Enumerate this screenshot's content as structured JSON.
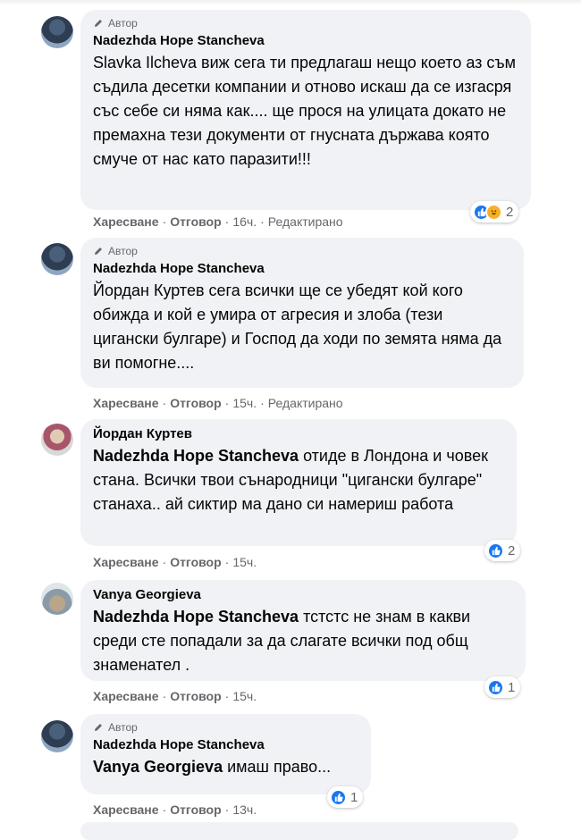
{
  "labels": {
    "author": "Автор",
    "like": "Харесване",
    "reply": "Отговор",
    "edited": "Редактирано"
  },
  "comments": [
    {
      "name": "Nadezhda Hope Stancheva",
      "is_author": true,
      "text": "Slavka Ilcheva виж сега ти предлагаш нещо което аз съм съдила десетки компании и отново искаш да се изгасря със себе си няма как.... ще прося на улицата докато не премахна тези документи от гнусната държава която смуче от нас като паразити!!!",
      "time": "16ч.",
      "edited": true,
      "reactions": [
        "like",
        "haha"
      ],
      "reaction_count": "2"
    },
    {
      "name": "Nadezhda Hope Stancheva",
      "is_author": true,
      "text": "Йордан Куртев сега всички ще се убедят кой кого обижда и кой е умира от агресия и злоба (тези цигански булгаре) и Господ да ходи по земята няма да ви помогне....",
      "time": "15ч.",
      "edited": true,
      "reactions": [],
      "reaction_count": ""
    },
    {
      "name": "Йордан Куртев",
      "is_author": false,
      "mention": "Nadezhda Hope Stancheva",
      "text": " отиде в Лондона и човек стана. Всички твои сънародници \"цигански булгаре\" станаха.. ай сиктир ма дано си намериш работа",
      "time": "15ч.",
      "edited": false,
      "reactions": [
        "like"
      ],
      "reaction_count": "2"
    },
    {
      "name": "Vanya Georgieva",
      "is_author": false,
      "mention": "Nadezhda Hope Stancheva",
      "text": " тстстс не знам в какви среди сте попадали за да слагате всички под общ знаменател .",
      "time": "15ч.",
      "edited": false,
      "reactions": [
        "like"
      ],
      "reaction_count": "1"
    },
    {
      "name": "Nadezhda Hope Stancheva",
      "is_author": true,
      "mention": "Vanya Georgieva",
      "text": " имаш право...",
      "time": "13ч.",
      "edited": false,
      "reactions": [
        "like"
      ],
      "reaction_count": "1"
    }
  ]
}
